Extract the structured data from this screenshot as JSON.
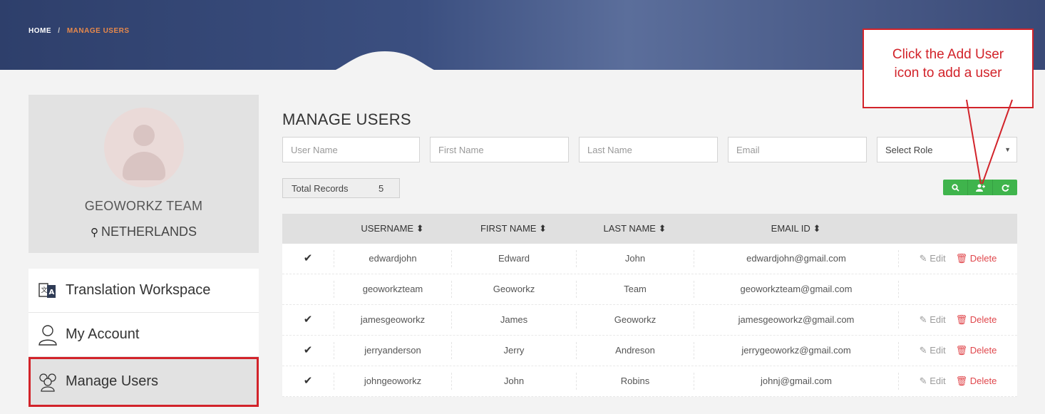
{
  "breadcrumb": {
    "home": "HOME",
    "separator": "/",
    "current": "MANAGE USERS"
  },
  "profile": {
    "name": "GEOWORKZ TEAM",
    "location": "NETHERLANDS"
  },
  "nav": {
    "items": [
      {
        "label": "Translation Workspace",
        "icon": "translate-icon"
      },
      {
        "label": "My Account",
        "icon": "user-icon"
      },
      {
        "label": "Manage Users",
        "icon": "users-icon",
        "active": true
      }
    ]
  },
  "main": {
    "title": "MANAGE USERS",
    "filters": {
      "username_placeholder": "User Name",
      "firstname_placeholder": "First Name",
      "lastname_placeholder": "Last Name",
      "email_placeholder": "Email",
      "role_selected": "Select Role"
    },
    "total_label": "Total Records",
    "total_count": "5",
    "buttons": [
      "search-icon",
      "add-user-icon",
      "refresh-icon"
    ],
    "table": {
      "headers": [
        "USERNAME",
        "FIRST NAME",
        "LAST NAME",
        "EMAIL ID"
      ],
      "sort_glyph": "⬍",
      "edit_label": "Edit",
      "delete_label": "Delete",
      "rows": [
        {
          "checked": true,
          "username": "edwardjohn",
          "first": "Edward",
          "last": "John",
          "email": "edwardjohn@gmail.com",
          "actions": true
        },
        {
          "checked": false,
          "username": "geoworkzteam",
          "first": "Geoworkz",
          "last": "Team",
          "email": "geoworkzteam@gmail.com",
          "actions": false
        },
        {
          "checked": true,
          "username": "jamesgeoworkz",
          "first": "James",
          "last": "Geoworkz",
          "email": "jamesgeoworkz@gmail.com",
          "actions": true
        },
        {
          "checked": true,
          "username": "jerryanderson",
          "first": "Jerry",
          "last": "Andreson",
          "email": "jerrygeoworkz@gmail.com",
          "actions": true
        },
        {
          "checked": true,
          "username": "johngeoworkz",
          "first": "John",
          "last": "Robins",
          "email": "johnj@gmail.com",
          "actions": true
        }
      ]
    }
  },
  "callout": {
    "line1": "Click the Add User",
    "line2": "icon to add a user"
  },
  "colors": {
    "accent_green": "#3fb44c",
    "annotation_red": "#d2232a",
    "breadcrumb_orange": "#e8894b",
    "banner_blue": "#3b4f80"
  }
}
